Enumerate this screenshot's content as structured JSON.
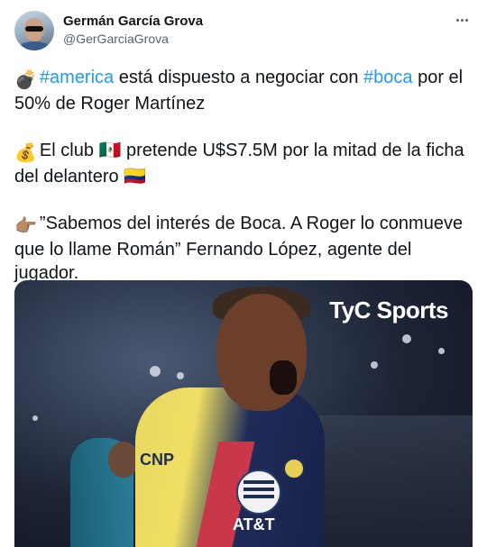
{
  "tweet": {
    "author_name": "Germán García Grova",
    "author_handle": "@GerGarciaGrova",
    "paragraphs": [
      {
        "emoji": "💣",
        "segments": [
          {
            "text": "#america",
            "hashtag": true
          },
          {
            "text": " está dispuesto a negociar con ",
            "hashtag": false
          },
          {
            "text": "#boca",
            "hashtag": true
          },
          {
            "text": " por el 50% de Roger Martínez",
            "hashtag": false
          }
        ]
      },
      {
        "emoji": "💰",
        "segments": [
          {
            "text": "El club 🇲🇽 pretende U$S7.5M por la mitad de la ficha del delantero 🇨🇴",
            "hashtag": false
          }
        ]
      },
      {
        "emoji": "👉🏽",
        "segments": [
          {
            "text": "”Sabemos del interés de Boca. A Roger lo conmueve que lo llame Román” Fernando López, agente del jugador.",
            "hashtag": false
          }
        ]
      }
    ],
    "media": {
      "watermark": "TyC Sports",
      "sponsor": "CNP",
      "jersey_text": "AT&T"
    }
  },
  "icons": {
    "more": "more-horizontal-icon",
    "avatar": "avatar"
  },
  "colors": {
    "hashtag": "#1d9bf0",
    "text": "#0f1419",
    "secondary": "#536471"
  }
}
